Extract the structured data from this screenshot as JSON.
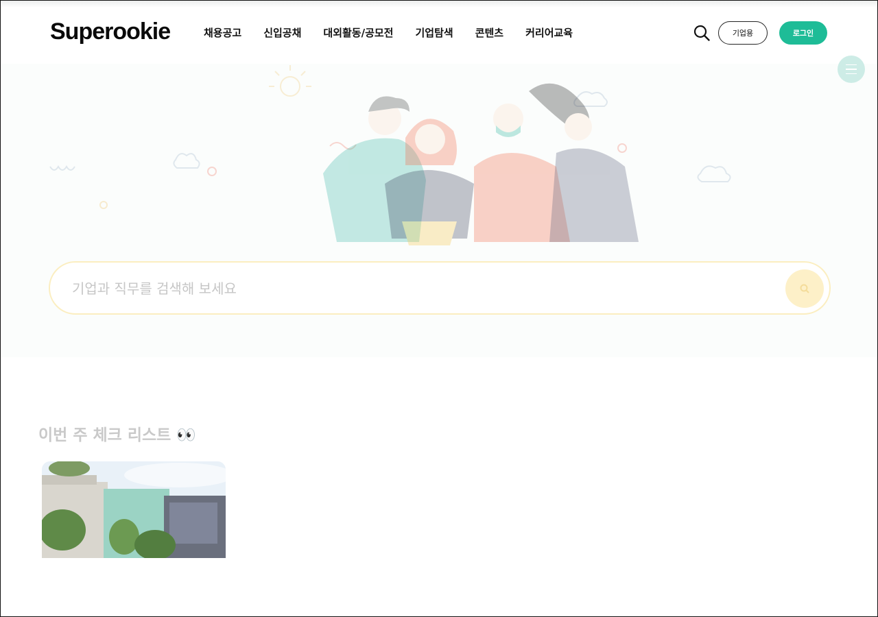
{
  "header": {
    "logo": "Superookie",
    "nav": [
      "채용공고",
      "신입공채",
      "대외활동/공모전",
      "기업탐색",
      "콘텐츠",
      "커리어교육"
    ],
    "corp_button": "기업용",
    "login_button": "로그인",
    "accent_color": "#1ebc97",
    "icons": [
      "search-icon",
      "hamburger-menu-icon"
    ]
  },
  "search": {
    "placeholder": "기업과 직무를 검색해 보세요"
  },
  "section": {
    "title": "이번 주 체크 리스트 👀"
  }
}
